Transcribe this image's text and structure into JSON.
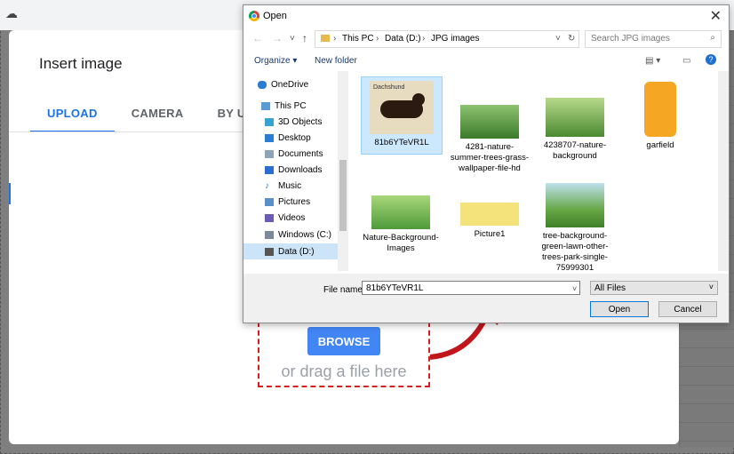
{
  "insert_dialog": {
    "title": "Insert image",
    "tabs": [
      {
        "label": "UPLOAD"
      },
      {
        "label": "CAMERA"
      },
      {
        "label": "BY URL"
      }
    ],
    "browse_label": "BROWSE",
    "drag_text": "or drag a file here"
  },
  "open_dialog": {
    "title": "Open",
    "breadcrumb": [
      "This PC",
      "Data (D:)",
      "JPG images"
    ],
    "search_placeholder": "Search JPG images",
    "organize_label": "Organize ▾",
    "new_folder_label": "New folder",
    "nav_items": [
      {
        "label": "OneDrive",
        "color": "#2b7cd3"
      },
      {
        "label": "This PC",
        "color": "#5a9bd5"
      },
      {
        "label": "3D Objects",
        "color": "#38a3d1"
      },
      {
        "label": "Desktop",
        "color": "#2b7cd3"
      },
      {
        "label": "Documents",
        "color": "#8ca3b8"
      },
      {
        "label": "Downloads",
        "color": "#2b6cd3"
      },
      {
        "label": "Music",
        "color": "#2b7cd3"
      },
      {
        "label": "Pictures",
        "color": "#5c8fc9"
      },
      {
        "label": "Videos",
        "color": "#6b5bb5"
      },
      {
        "label": "Windows (C:)",
        "color": "#7a8a9a"
      },
      {
        "label": "Data (D:)",
        "color": "#555555"
      }
    ],
    "files": [
      {
        "name": "81b6YTeVR1L",
        "selected": true,
        "thumb_caption": "Dachshund"
      },
      {
        "name": "4281-nature-summer-trees-grass-wallpaper-file-hd",
        "selected": false
      },
      {
        "name": "4238707-nature-background",
        "selected": false
      },
      {
        "name": "garfield",
        "selected": false
      },
      {
        "name": "Nature-Background-Images",
        "selected": false
      },
      {
        "name": "Picture1",
        "selected": false
      },
      {
        "name": "tree-background-green-lawn-other-trees-park-single-75999301",
        "selected": false
      }
    ],
    "file_name_label": "File name:",
    "file_name_value": "81b6YTeVR1L",
    "file_type_value": "All Files",
    "open_label": "Open",
    "cancel_label": "Cancel"
  },
  "colors": {
    "accent_blue": "#1a73e8",
    "browse_blue": "#4285f4",
    "highlight_red": "#d61f1f"
  }
}
